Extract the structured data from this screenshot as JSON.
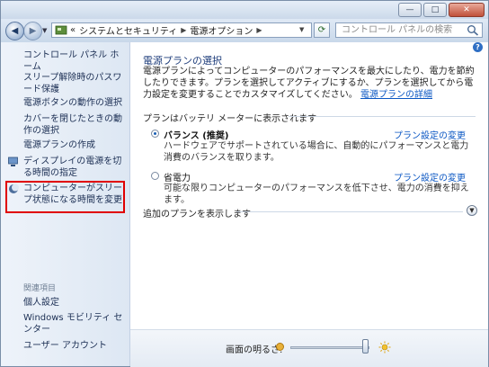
{
  "addressbar": {
    "breadcrumb_prefix": "«",
    "path": [
      "システムとセキュリティ",
      "電源オプション"
    ],
    "search_placeholder": "コントロール パネルの検索"
  },
  "sidebar": {
    "home": "コントロール パネル ホーム",
    "items": [
      "スリープ解除時のパスワード保護",
      "電源ボタンの動作の選択",
      "カバーを閉じたときの動作の選択",
      "電源プランの作成",
      "ディスプレイの電源を切る時間の指定",
      "コンピューターがスリープ状態になる時間を変更"
    ],
    "related_header": "関連項目",
    "related_items": [
      "個人設定",
      "Windows モビリティ センター",
      "ユーザー アカウント"
    ]
  },
  "content": {
    "title": "電源プランの選択",
    "description": "電源プランによってコンピューターのパフォーマンスを最大にしたり、電力を節約したりできます。プランを選択してアクティブにするか、プランを選択してから電力設定を変更することでカスタマイズしてください。",
    "description_link": "電源プランの詳細",
    "group_label": "プランはバッテリ メーターに表示されます",
    "plans": [
      {
        "name": "バランス (推奨)",
        "selected": true,
        "link": "プラン設定の変更",
        "desc": "ハードウェアでサポートされている場合に、自動的にパフォーマンスと電力消費のバランスを取ります。"
      },
      {
        "name": "省電力",
        "selected": false,
        "link": "プラン設定の変更",
        "desc": "可能な限りコンピューターのパフォーマンスを低下させ、電力の消費を抑えます。"
      }
    ],
    "more_plans": "追加のプランを表示します"
  },
  "status": {
    "brightness_label": "画面の明るさ:",
    "brightness_fraction": 0.95
  },
  "colors": {
    "link": "#0b57c3",
    "highlight_border": "#e00000",
    "title": "#1e3d7b"
  }
}
